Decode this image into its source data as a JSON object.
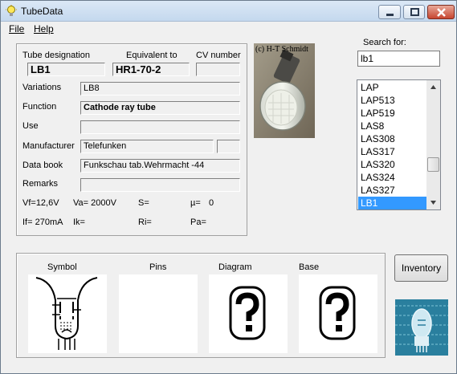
{
  "window": {
    "title": "TubeData"
  },
  "menu": {
    "file": "File",
    "help": "Help"
  },
  "tube": {
    "designation_label": "Tube designation",
    "designation": "LB1",
    "equivalent_label": "Equivalent to",
    "equivalent": "HR1-70-2",
    "cv_label": "CV number",
    "cv": "",
    "variations_label": "Variations",
    "variations": "LB8",
    "function_label": "Function",
    "function": "Cathode ray tube",
    "use_label": "Use",
    "use": "",
    "manufacturer_label": "Manufacturer",
    "manufacturer": "Telefunken",
    "manufacturer_extra": "",
    "databook_label": "Data book",
    "databook": "Funkschau tab.Wehrmacht -44",
    "remarks_label": "Remarks",
    "remarks": ""
  },
  "params": {
    "vf": "Vf=12,6V",
    "va": "Va= 2000V",
    "s": "S=",
    "mu": "µ=",
    "mu_value": "0",
    "if": "If= 270mA",
    "ik": "Ik=",
    "ri": "Ri=",
    "pa": "Pa="
  },
  "photo": {
    "caption": "(c) H-T Schmidt"
  },
  "search": {
    "label": "Search for:",
    "value": "lb1"
  },
  "list": {
    "items": [
      "LAP",
      "LAP513",
      "LAP519",
      "LAS8",
      "LAS308",
      "LAS317",
      "LAS320",
      "LAS324",
      "LAS327",
      "LB1"
    ],
    "selected": "LB1"
  },
  "panes": {
    "symbol": "Symbol",
    "pins": "Pins",
    "diagram": "Diagram",
    "base": "Base"
  },
  "buttons": {
    "inventory": "Inventory"
  },
  "colors": {
    "selection": "#3399ff",
    "window_bg": "#f0f0f0"
  }
}
